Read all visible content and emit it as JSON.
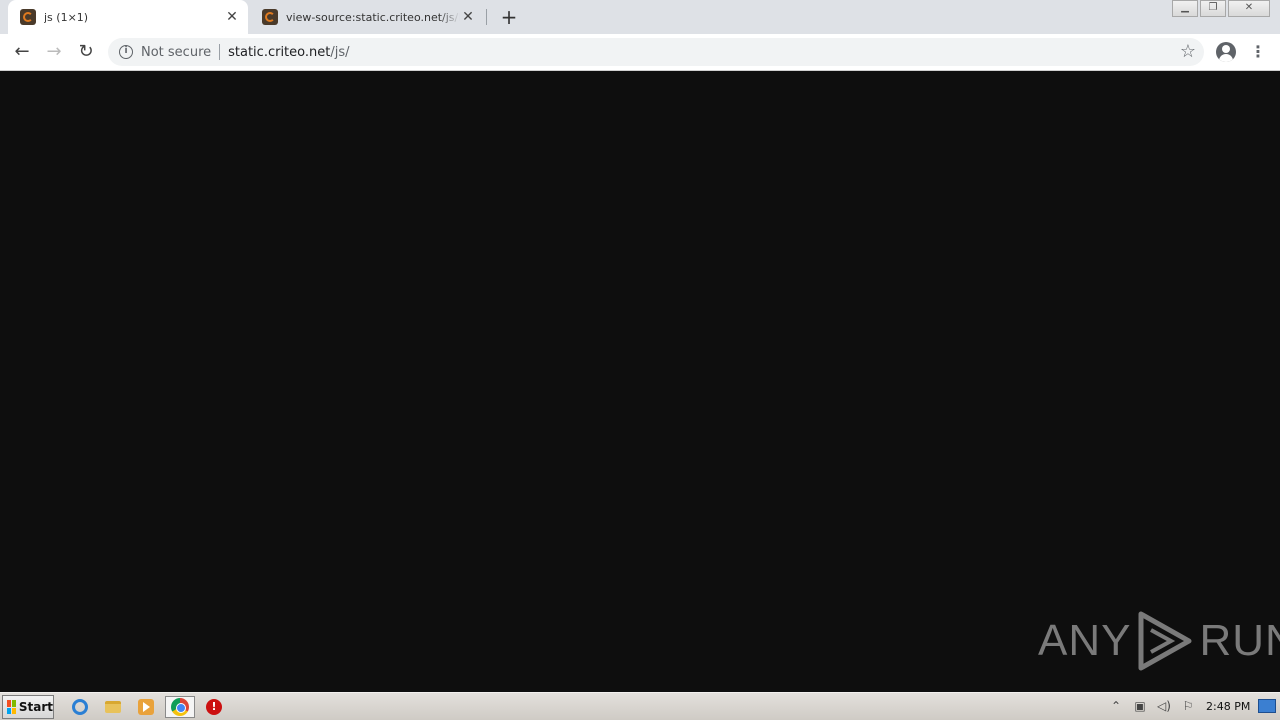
{
  "browser": {
    "tabs": [
      {
        "title": "js (1×1)",
        "active": true
      },
      {
        "title": "view-source:static.criteo.net/js/ld/p",
        "active": false
      }
    ],
    "new_tab_icon": "plus-icon",
    "address_bar": {
      "security_label": "Not secure",
      "host": "static.criteo.net",
      "path": "/js/"
    }
  },
  "watermark": {
    "left_text": "ANY",
    "right_text": "RUN"
  },
  "taskbar": {
    "start_label": "Start",
    "apps": [
      "internet-explorer-icon",
      "file-explorer-icon",
      "media-player-icon",
      "chrome-icon",
      "stop-icon"
    ],
    "clock": "2:48 PM"
  },
  "colors": {
    "page_background": "#0e0e0e",
    "tabstrip": "#dee1e6",
    "taskbar": "#d6d2cc"
  }
}
